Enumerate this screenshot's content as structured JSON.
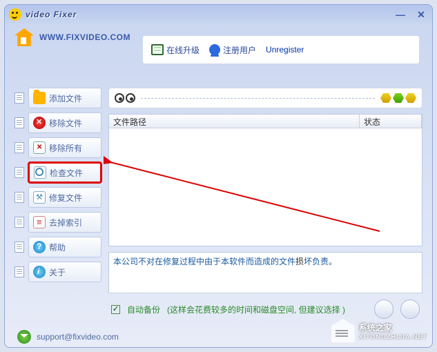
{
  "window": {
    "title": "video Fixer"
  },
  "header": {
    "url": "WWW.FIXVIDEO.COM"
  },
  "toolbar": {
    "upgrade": "在线升级",
    "register": "注册用户",
    "unregister": "Unregister"
  },
  "sidebar": {
    "items": [
      {
        "label": "添加文件"
      },
      {
        "label": "移除文件"
      },
      {
        "label": "移除所有"
      },
      {
        "label": "检查文件"
      },
      {
        "label": "修复文件"
      },
      {
        "label": "去掉索引"
      },
      {
        "label": "帮助"
      },
      {
        "label": "关于"
      }
    ]
  },
  "list": {
    "columns": {
      "path": "文件路径",
      "status": "状态"
    },
    "rows": []
  },
  "message": {
    "prefix": "本公司不对在修复过程中由于本软件而造成的文件",
    "hot": "损",
    "suffix": "坏负责。"
  },
  "backup": {
    "checkbox_label": "自动备份",
    "hint": "(这样会花费较多的时间和磁盘空间, 但建议选择 )",
    "checked": true
  },
  "footer": {
    "email": "support@fixvideo.com"
  },
  "watermark": {
    "title": "系统之家",
    "sub": "XITONGZHIJIA.NET"
  }
}
